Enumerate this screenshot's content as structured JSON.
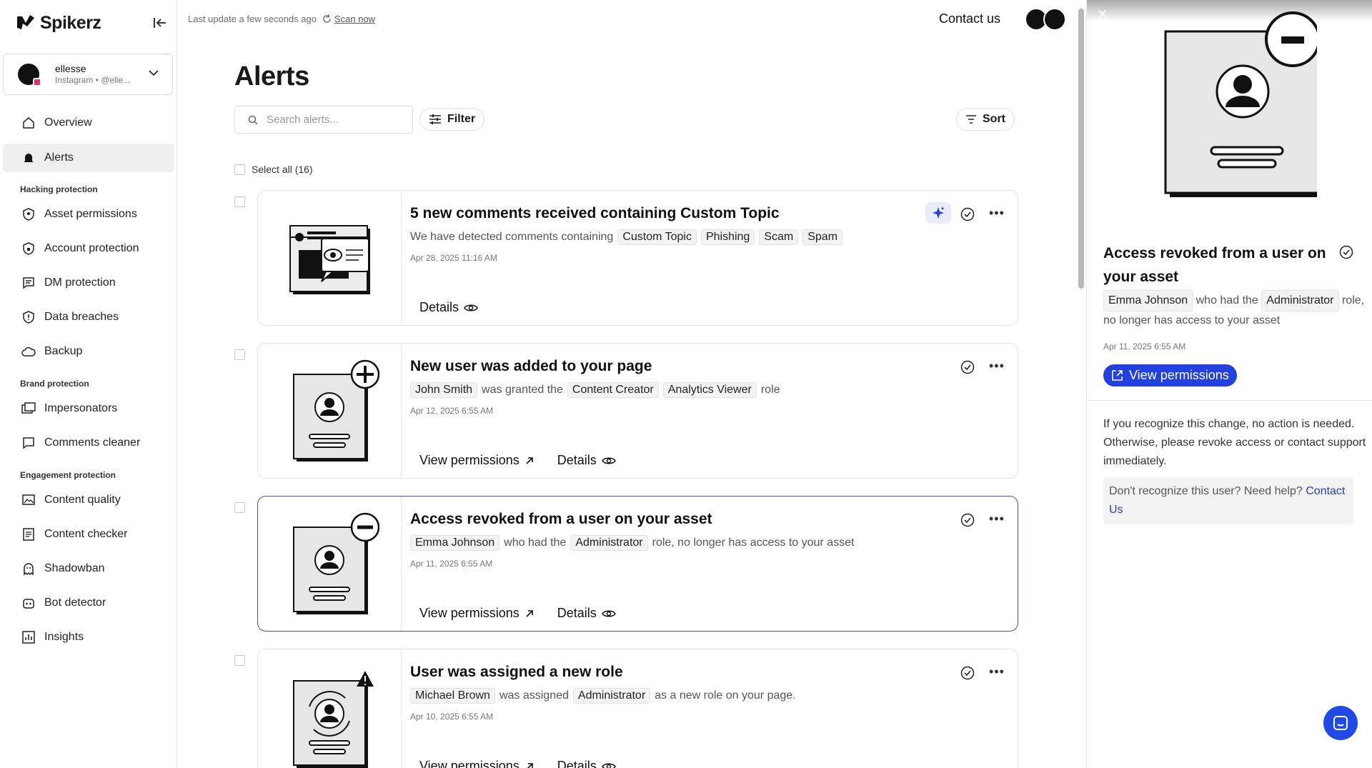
{
  "app": {
    "brand": "Spikerz"
  },
  "account": {
    "name": "ellesse",
    "sub": "Instagram • @elle..."
  },
  "nav": {
    "overview": "Overview",
    "alerts": "Alerts",
    "section_hacking": "Hacking protection",
    "asset_permissions": "Asset permissions",
    "account_protection": "Account protection",
    "dm_protection": "DM protection",
    "data_breaches": "Data breaches",
    "backup": "Backup",
    "section_brand": "Brand protection",
    "impersonators": "Impersonators",
    "comments_cleaner": "Comments cleaner",
    "section_engagement": "Engagement protection",
    "content_quality": "Content quality",
    "content_checker": "Content checker",
    "shadowban": "Shadowban",
    "bot_detector": "Bot detector",
    "insights": "Insights"
  },
  "topbar": {
    "last_update": "Last update a few seconds ago",
    "scan_now": "Scan now",
    "contact": "Contact us"
  },
  "page": {
    "title": "Alerts",
    "search_placeholder": "Search alerts...",
    "filter": "Filter",
    "sort": "Sort",
    "select_all": "Select all (16)"
  },
  "alerts": [
    {
      "title": "5 new comments received containing Custom Topic",
      "desc_pre": "We have detected comments containing",
      "tags": [
        "Custom Topic",
        "Phishing",
        "Scam",
        "Spam"
      ],
      "date": "Apr 28, 2025 11:16 AM",
      "details": "Details"
    },
    {
      "title": "New user was added to your page",
      "tag1": "John Smith",
      "mid": "was granted the",
      "tag2": "Content Creator",
      "tag3": "Analytics Viewer",
      "post": "role",
      "date": "Apr 12, 2025 6:55 AM",
      "view": "View permissions",
      "details": "Details"
    },
    {
      "title": "Access revoked from a user on your asset",
      "tag1": "Emma Johnson",
      "mid": "who had the",
      "tag2": "Administrator",
      "post": "role, no longer has access to your asset",
      "date": "Apr 11, 2025 6:55 AM",
      "view": "View permissions",
      "details": "Details"
    },
    {
      "title": "User was assigned a new role",
      "tag1": "Michael Brown",
      "mid": "was assigned",
      "tag2": "Administrator",
      "post": "as a new role on your page.",
      "date": "Apr 10, 2025 6:55 AM",
      "view": "View permissions",
      "details": "Details"
    }
  ],
  "panel": {
    "title": "Access revoked from a user on your asset",
    "user": "Emma Johnson",
    "mid": "who had the",
    "role": "Administrator",
    "post": "role, no longer has access to your asset",
    "date": "Apr 11, 2025 6:55 AM",
    "button": "View permissions",
    "note": "If you recognize this change, no action is needed. Otherwise, please revoke access or contact support immediately.",
    "help": "Don't recognize this user? Need help?",
    "help_link": "Contact Us"
  },
  "colors": {
    "accent": "#2340e0",
    "selected_border": "#4a4ad0"
  }
}
